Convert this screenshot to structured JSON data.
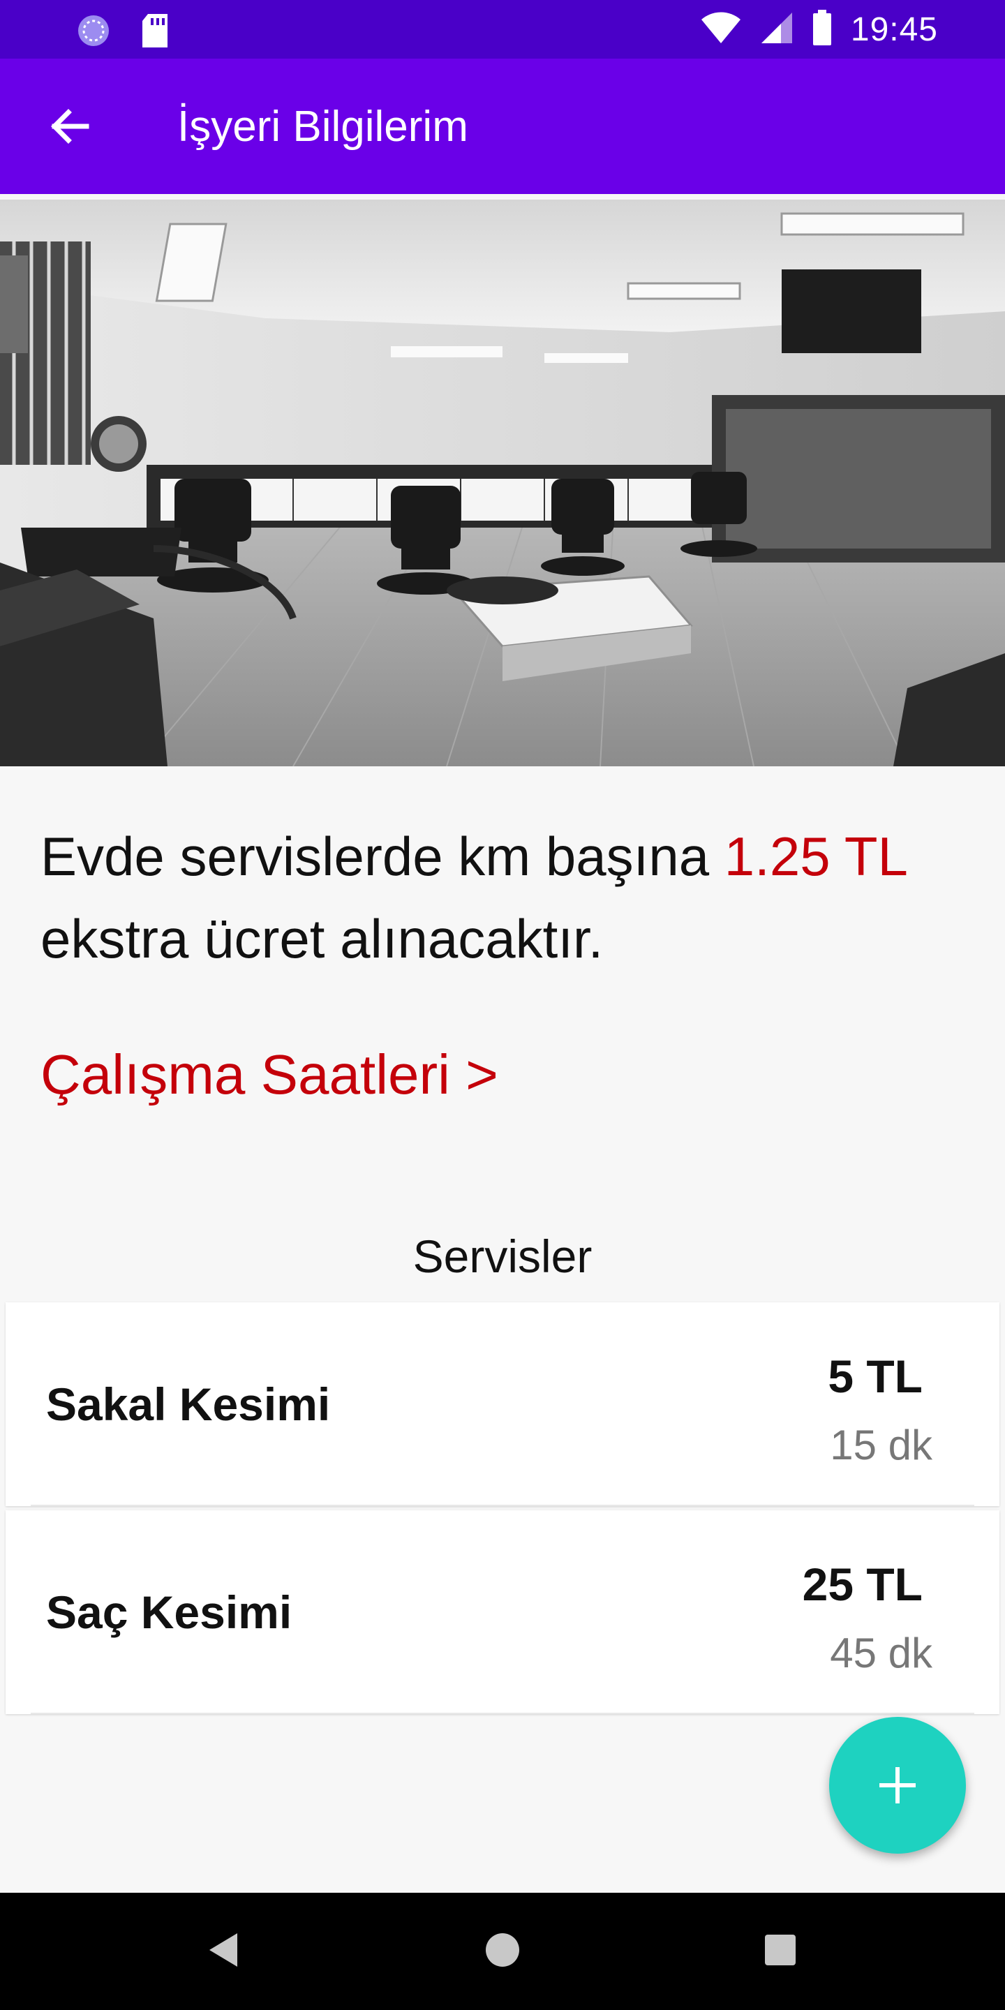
{
  "status_bar": {
    "time": "19:45",
    "left_icons": [
      "sync-icon",
      "sd-card-icon"
    ],
    "right_icons": [
      "wifi-icon",
      "signal-icon",
      "battery-icon"
    ]
  },
  "app_bar": {
    "title": "İşyeri Bilgilerim",
    "back_icon": "arrow-back-icon"
  },
  "hero_image": {
    "description": "salon-photo"
  },
  "info": {
    "text_before": "Evde servislerde km başına ",
    "price": "1.25 TL",
    "text_after": "ekstra ücret alınacaktır."
  },
  "working_hours_link": "Çalışma Saatleri >",
  "services": {
    "title": "Servisler",
    "items": [
      {
        "name": "Sakal Kesimi",
        "price": "5 TL",
        "duration": "15 dk"
      },
      {
        "name": "Saç Kesimi",
        "price": "25 TL",
        "duration": "45 dk"
      }
    ]
  },
  "fab": {
    "icon": "plus-icon"
  },
  "nav_bar": {
    "icons": [
      "back-nav-icon",
      "home-nav-icon",
      "recents-nav-icon"
    ]
  },
  "colors": {
    "status_bar": "#4a00c8",
    "app_bar": "#6a00e8",
    "accent_red": "#c4000a",
    "fab": "#1ed2c0"
  }
}
